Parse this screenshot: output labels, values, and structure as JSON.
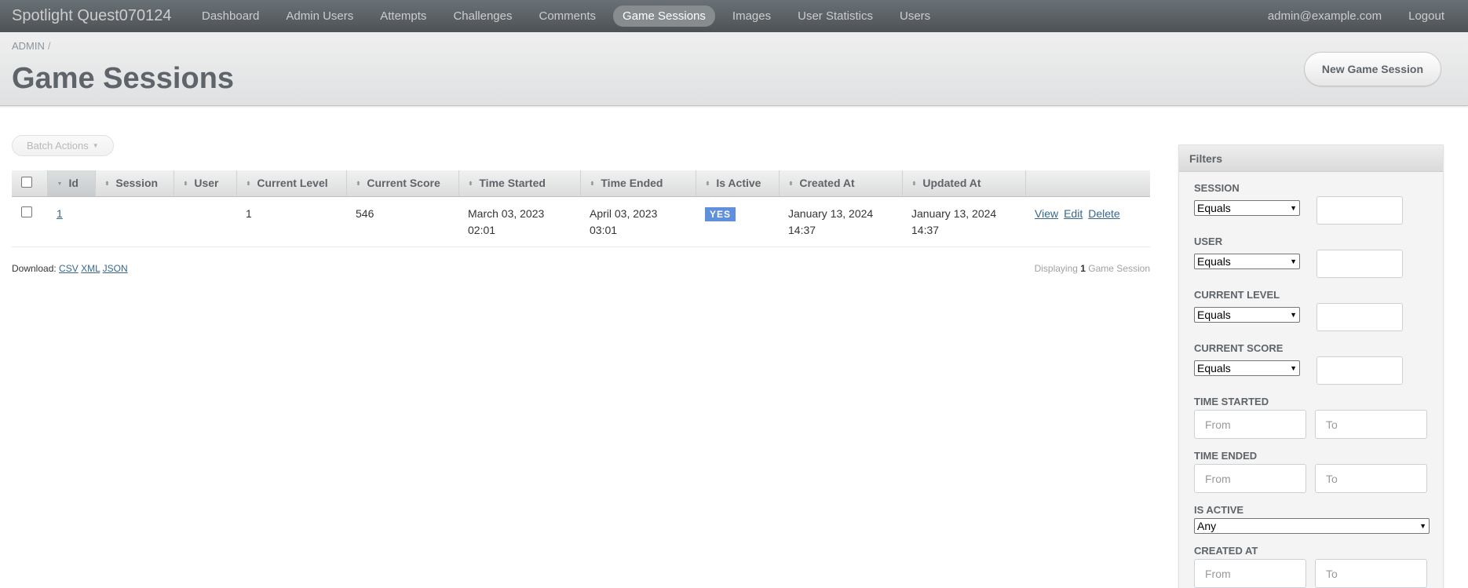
{
  "header": {
    "site_title": "Spotlight Quest070124",
    "nav": [
      "Dashboard",
      "Admin Users",
      "Attempts",
      "Challenges",
      "Comments",
      "Game Sessions",
      "Images",
      "User Statistics",
      "Users"
    ],
    "active_nav": "Game Sessions",
    "user_email": "admin@example.com",
    "logout_label": "Logout"
  },
  "title_bar": {
    "breadcrumb": "ADMIN",
    "breadcrumb_sep": "/",
    "page_title": "Game Sessions",
    "new_button": "New Game Session"
  },
  "main": {
    "batch_actions_label": "Batch Actions",
    "columns": [
      "Id",
      "Session",
      "User",
      "Current Level",
      "Current Score",
      "Time Started",
      "Time Ended",
      "Is Active",
      "Created At",
      "Updated At"
    ],
    "rows": [
      {
        "id": "1",
        "session": "",
        "user": "",
        "current_level": "1",
        "current_score": "546",
        "time_started_1": "March 03, 2023",
        "time_started_2": "02:01",
        "time_ended_1": "April 03, 2023",
        "time_ended_2": "03:01",
        "is_active": "YES",
        "created_at_1": "January 13, 2024",
        "created_at_2": "14:37",
        "updated_at_1": "January 13, 2024",
        "updated_at_2": "14:37",
        "actions": [
          "View",
          "Edit",
          "Delete"
        ]
      }
    ],
    "download_label": "Download:",
    "download_formats": [
      "CSV",
      "XML",
      "JSON"
    ],
    "pagination_prefix": "Displaying",
    "pagination_count": "1",
    "pagination_suffix": "Game Session"
  },
  "sidebar": {
    "title": "Filters",
    "filters": {
      "session_label": "SESSION",
      "user_label": "USER",
      "current_level_label": "CURRENT LEVEL",
      "current_score_label": "CURRENT SCORE",
      "time_started_label": "TIME STARTED",
      "time_ended_label": "TIME ENDED",
      "is_active_label": "IS ACTIVE",
      "created_at_label": "CREATED AT",
      "equals_option": "Equals",
      "any_option": "Any",
      "from_placeholder": "From",
      "to_placeholder": "To"
    }
  }
}
